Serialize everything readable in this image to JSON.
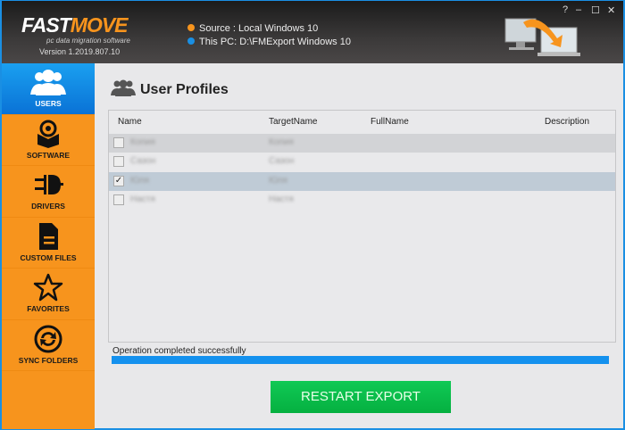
{
  "header": {
    "logo_left": "FAST",
    "logo_right": "MOVE",
    "tagline": "pc data migration software",
    "version": "Version 1.2019.807.10",
    "source": "Source : Local Windows 10",
    "target": "This PC: D:\\FMExport Windows 10",
    "source_color": "#f7941d",
    "target_color": "#1a8fe3",
    "controls": {
      "help": "?",
      "minimize": "–",
      "maximize": "☐",
      "close": "✕"
    }
  },
  "sidebar": {
    "items": [
      {
        "label": "USERS",
        "icon": "users-icon",
        "active": true
      },
      {
        "label": "SOFTWARE",
        "icon": "software-icon"
      },
      {
        "label": "DRIVERS",
        "icon": "plug-icon"
      },
      {
        "label": "CUSTOM FILES",
        "icon": "file-icon"
      },
      {
        "label": "FAVORITES",
        "icon": "star-icon"
      },
      {
        "label": "SYNC FOLDERS",
        "icon": "sync-icon"
      }
    ]
  },
  "main": {
    "title": "User Profiles",
    "columns": [
      "Name",
      "TargetName",
      "FullName",
      "Description"
    ],
    "rows": [
      {
        "name": "Копия",
        "target": "Копия",
        "checked": false
      },
      {
        "name": "Сазон",
        "target": "Сазон",
        "checked": false
      },
      {
        "name": "Юля",
        "target": "Юля",
        "checked": true
      },
      {
        "name": "Настя",
        "target": "Настя",
        "checked": false
      }
    ],
    "status": "Operation completed successfully",
    "progress_percent": 100,
    "button": "RESTART EXPORT"
  }
}
